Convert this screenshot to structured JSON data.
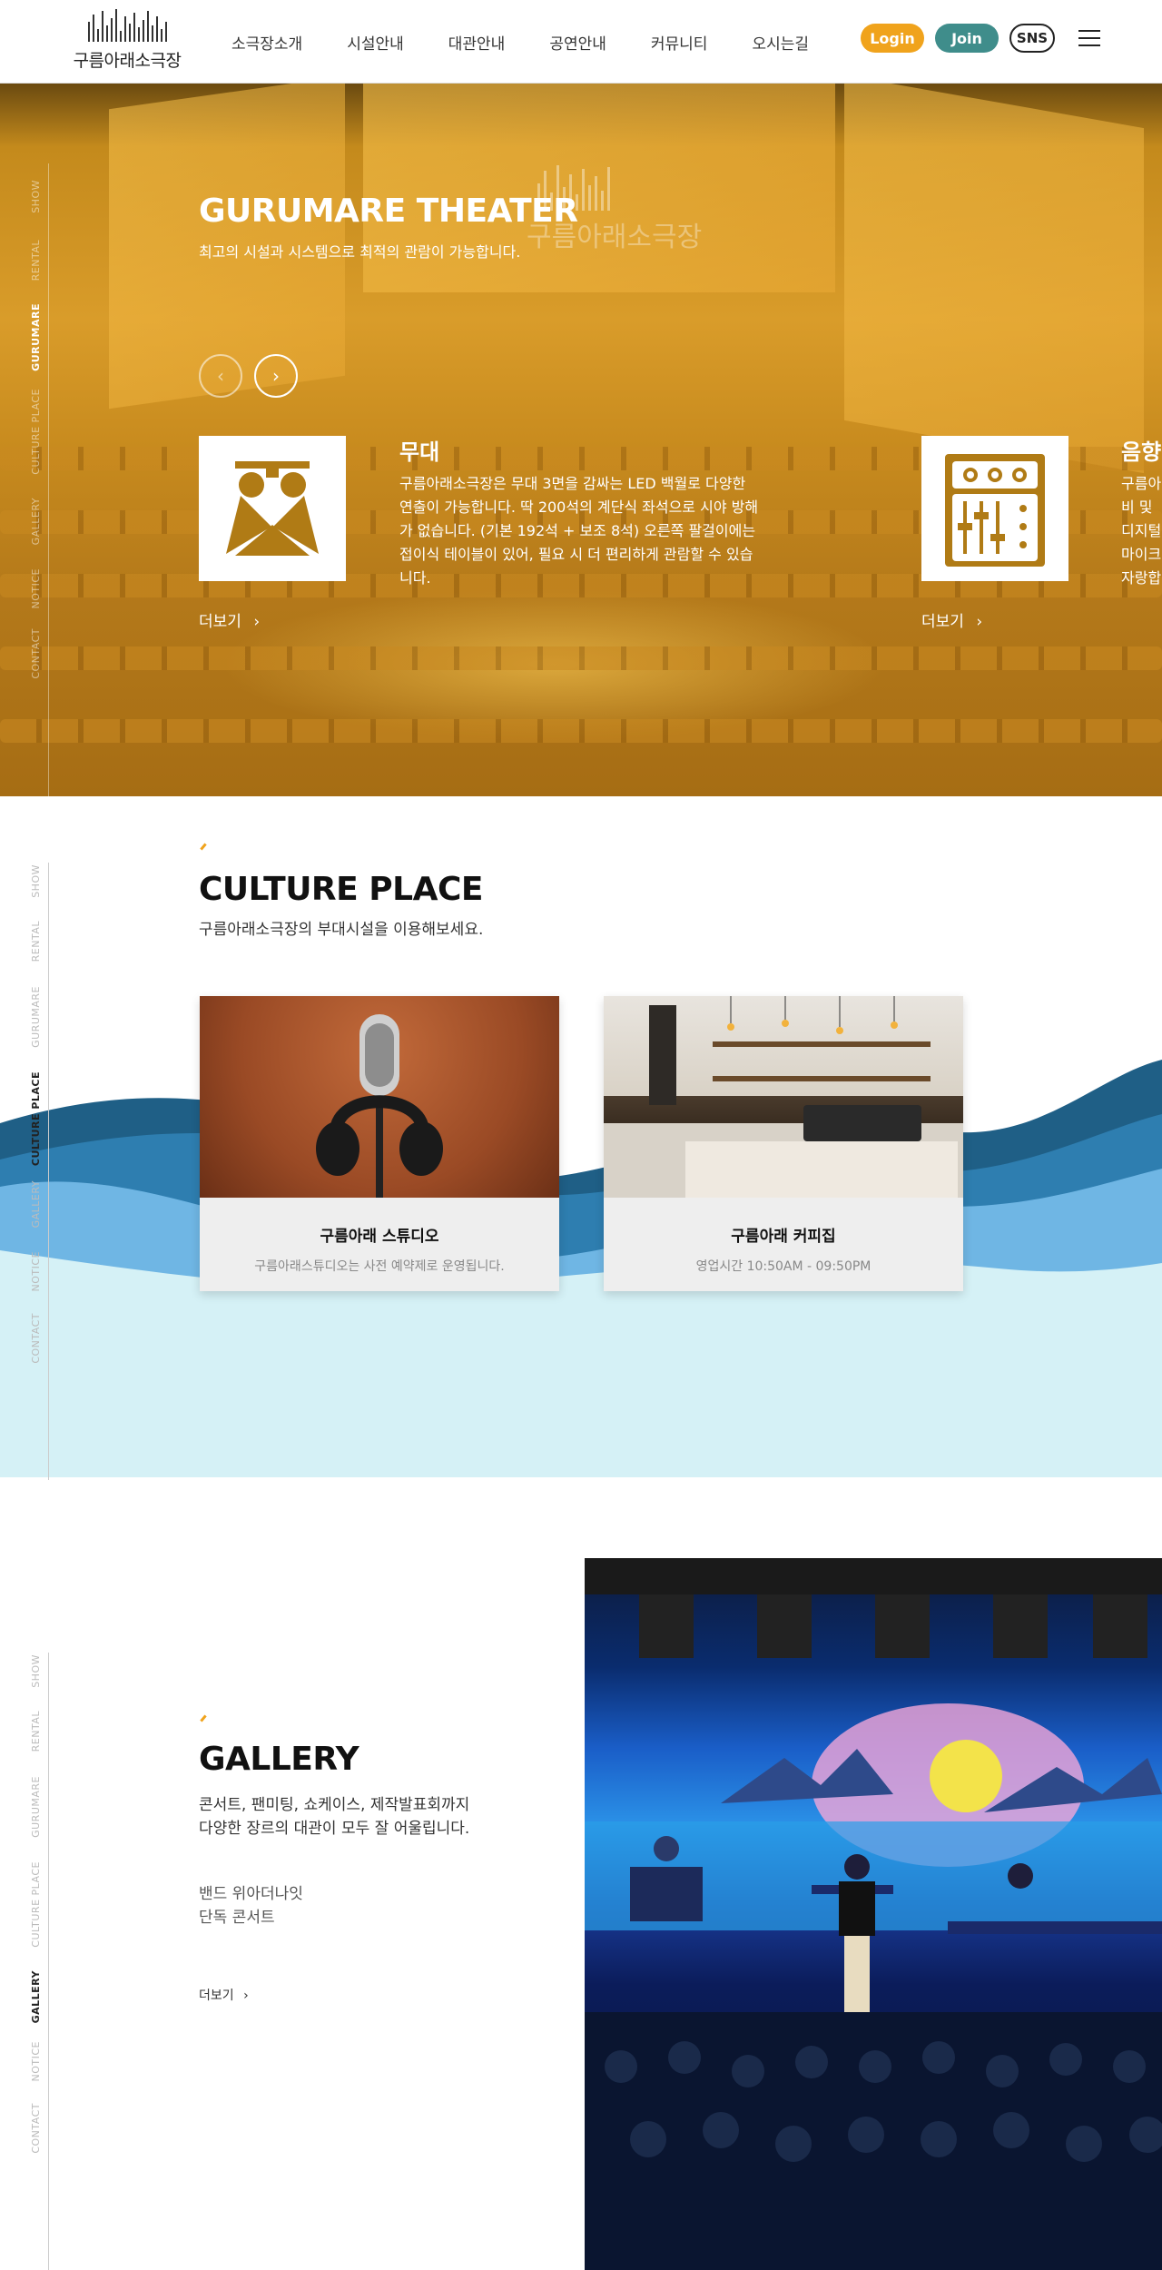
{
  "header": {
    "logo_text": "구름아래소극장",
    "nav": [
      "소극장소개",
      "시설안내",
      "대관안내",
      "공연안내",
      "커뮤니티",
      "오시는길"
    ],
    "login_label": "Login",
    "join_label": "Join",
    "sns_label": "SNS"
  },
  "sidenav": [
    "SHOW",
    "RENTAL",
    "GURUMARE",
    "CULTURE PLACE",
    "GALLERY",
    "NOTICE",
    "CONTACT"
  ],
  "hero": {
    "title": "GURUMARE THEATER",
    "subtitle": "최고의 시설과 시스템으로 최적의 관람이 가능합니다.",
    "watermark": "구름아래소극장",
    "features": [
      {
        "title": "무대",
        "description": "구름아래소극장은 무대 3면을 감싸는 LED 백월로 다양한 연출이 가능합니다. 딱 200석의 계단식 좌석으로 시야 방해가 없습니다. (기본 192석 + 보조 8석) 오른쪽 팔걸이에는 접이식 테이블이 있어, 필요 시 더 편리하게 관람할 수 있습니다.",
        "more_label": "더보기"
      },
      {
        "title": "음향",
        "description": "구름아\n비 및\n디지털\n마이크\n자랑합",
        "more_label": "더보기"
      }
    ]
  },
  "culture": {
    "title": "CULTURE PLACE",
    "subtitle": "구름아래소극장의 부대시설을 이용해보세요.",
    "cards": [
      {
        "title": "구름아래 스튜디오",
        "desc": "구름아래스튜디오는 사전 예약제로 운영됩니다."
      },
      {
        "title": "구름아래 커피집",
        "desc": "영업시간 10:50AM - 09:50PM"
      }
    ]
  },
  "gallery": {
    "title": "GALLERY",
    "subtitle_line1": "콘서트, 팬미팅, 쇼케이스, 제작발표회까지",
    "subtitle_line2": "다양한 장르의 대관이 모두 잘 어울립니다.",
    "item_line1": "밴드 위아더나잇",
    "item_line2": "단독 콘서트",
    "more_label": "더보기"
  },
  "colors": {
    "accent_yellow": "#f0a31c",
    "accent_teal": "#3f8d8b",
    "wave_dark": "#1f5f86",
    "wave_light": "#6fb6e4",
    "wave_pale": "#d5f1f6"
  }
}
